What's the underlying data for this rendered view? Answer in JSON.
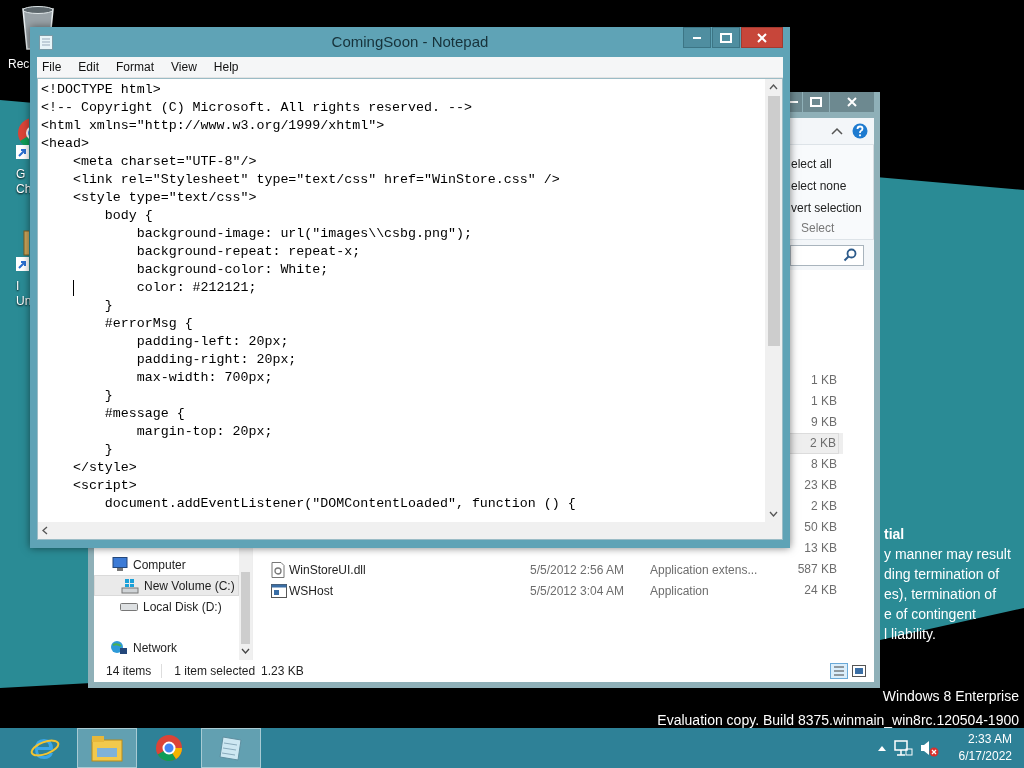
{
  "desktop": {
    "icons": [
      {
        "kind": "recycle-bin",
        "label_lines": [
          "Rec"
        ]
      },
      {
        "kind": "browser",
        "label_lines": [
          "G",
          "Ch"
        ]
      },
      {
        "kind": "installer",
        "label_lines": [
          "I",
          "Un"
        ]
      }
    ],
    "background_text": {
      "heading": "tial",
      "lines": [
        "y manner may result",
        "ding termination of",
        "es), termination of",
        "e of contingent",
        "l liability."
      ]
    },
    "os_notice": [
      "Windows 8 Enterprise",
      "Evaluation copy. Build 8375.winmain_win8rc.120504-1900"
    ]
  },
  "explorer": {
    "ribbon_items": [
      "elect all",
      "elect none",
      "vert selection"
    ],
    "ribbon_group": "Select",
    "nav_items": [
      {
        "kind": "computer",
        "label": "Computer",
        "selected": false
      },
      {
        "kind": "drive-windows",
        "label": "New Volume (C:)",
        "selected": true
      },
      {
        "kind": "drive",
        "label": "Local Disk (D:)",
        "selected": false
      },
      {
        "kind": "network",
        "label": "Network",
        "selected": false
      }
    ],
    "files": [
      {
        "size": "1 KB",
        "selected": false
      },
      {
        "size": "1 KB",
        "selected": false
      },
      {
        "size": "9 KB",
        "selected": false
      },
      {
        "size": "2 KB",
        "selected": true
      },
      {
        "size": "8 KB",
        "selected": false
      },
      {
        "size": "23 KB",
        "selected": false
      },
      {
        "size": "2 KB",
        "selected": false
      },
      {
        "size": "50 KB",
        "selected": false
      },
      {
        "size": "13 KB",
        "selected": false
      },
      {
        "kind": "dll",
        "name": "WinStoreUI.dll",
        "date": "5/5/2012 2:56 AM",
        "type": "Application extens...",
        "size": "587 KB",
        "selected": false
      },
      {
        "kind": "exe",
        "name": "WSHost",
        "date": "5/5/2012 3:04 AM",
        "type": "Application",
        "size": "24 KB",
        "selected": false
      }
    ],
    "status": {
      "count": "14 items",
      "selection": "1 item selected",
      "selection_size": "1.23 KB"
    }
  },
  "notepad": {
    "title": "ComingSoon - Notepad",
    "menu": [
      "File",
      "Edit",
      "Format",
      "View",
      "Help"
    ],
    "lines": [
      {
        "text": "<!DOCTYPE html>",
        "caret": false
      },
      {
        "text": "<!-- Copyright (C) Microsoft. All rights reserved. -->",
        "caret": false
      },
      {
        "text": "<html xmlns=\"http://www.w3.org/1999/xhtml\">",
        "caret": false
      },
      {
        "text": "<head>",
        "caret": false
      },
      {
        "text": "    <meta charset=\"UTF-8\"/>",
        "caret": false
      },
      {
        "text": "    <link rel=\"Stylesheet\" type=\"text/css\" href=\"WinStore.css\" />",
        "caret": false
      },
      {
        "text": "    <style type=\"text/css\">",
        "caret": false
      },
      {
        "text": "        body {",
        "caret": false
      },
      {
        "text": "            background-image: url(\"images\\\\csbg.png\");",
        "caret": false
      },
      {
        "text": "            background-repeat: repeat-x;",
        "caret": false
      },
      {
        "text": "            background-color: White;",
        "caret": false
      },
      {
        "text": "            color: #212121;",
        "caret": true
      },
      {
        "text": "        }",
        "caret": false
      },
      {
        "text": "        #errorMsg {",
        "caret": false
      },
      {
        "text": "            padding-left: 20px;",
        "caret": false
      },
      {
        "text": "            padding-right: 20px;",
        "caret": false
      },
      {
        "text": "            max-width: 700px;",
        "caret": false
      },
      {
        "text": "        }",
        "caret": false
      },
      {
        "text": "        #message {",
        "caret": false
      },
      {
        "text": "            margin-top: 20px;",
        "caret": false
      },
      {
        "text": "        }",
        "caret": false
      },
      {
        "text": "    </style>",
        "caret": false
      },
      {
        "text": "    <script>",
        "caret": false
      },
      {
        "text": "        document.addEventListener(\"DOMContentLoaded\", function () {",
        "caret": false
      }
    ]
  },
  "taskbar": {
    "apps": [
      {
        "kind": "ie",
        "active": false
      },
      {
        "kind": "explorer",
        "active": true
      },
      {
        "kind": "chrome",
        "active": false
      },
      {
        "kind": "notepad",
        "active": true
      }
    ],
    "time": "2:33 AM",
    "date": "6/17/2022"
  }
}
